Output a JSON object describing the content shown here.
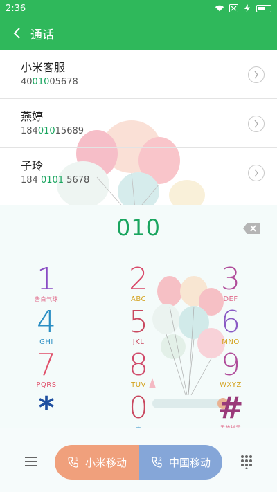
{
  "status_bar": {
    "time": "2:36"
  },
  "app_bar": {
    "title": "通话"
  },
  "contacts": [
    {
      "name": "小米客服",
      "number_pre": "40",
      "number_hl": "010",
      "number_post": "05678"
    },
    {
      "name": "燕婷",
      "number_pre": "184",
      "number_hl": "010",
      "number_post": "15689"
    },
    {
      "name": "子玲",
      "number_pre": "184 ",
      "number_hl": "0101",
      "number_post": " 5678"
    }
  ],
  "dialer": {
    "display": "010",
    "keys": [
      {
        "digit": "1",
        "letters": "告白气球"
      },
      {
        "digit": "2",
        "letters": "ABC"
      },
      {
        "digit": "3",
        "letters": "DEF"
      },
      {
        "digit": "4",
        "letters": "GHI"
      },
      {
        "digit": "5",
        "letters": "JKL"
      },
      {
        "digit": "6",
        "letters": "MNO"
      },
      {
        "digit": "7",
        "letters": "PQRS"
      },
      {
        "digit": "8",
        "letters": "TUV"
      },
      {
        "digit": "9",
        "letters": "WXYZ"
      },
      {
        "digit": "*",
        "letters": ","
      },
      {
        "digit": "0",
        "letters": "+"
      },
      {
        "digit": "#",
        "letters": "手势指示"
      }
    ]
  },
  "bottom_bar": {
    "sim1_label": "小米移动",
    "sim2_label": "中国移动"
  },
  "colors": {
    "accent": "#2fb85b",
    "highlight": "#1aa55f",
    "sim1": "#f0a07c",
    "sim2": "#85a6d8"
  }
}
